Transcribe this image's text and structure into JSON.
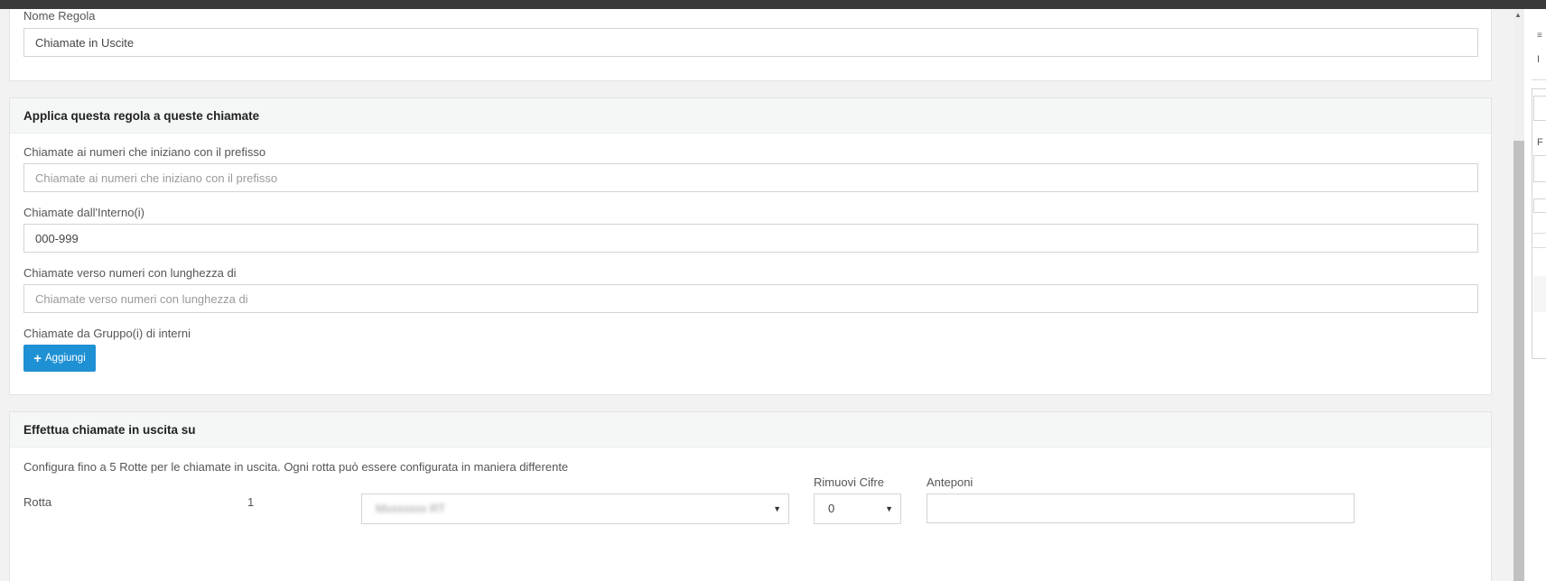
{
  "rule": {
    "name_label": "Nome Regola",
    "name_value": "Chiamate in Uscite"
  },
  "apply": {
    "title": "Applica questa regola a queste chiamate",
    "prefix_label": "Chiamate ai numeri che iniziano con il prefisso",
    "prefix_placeholder": "Chiamate ai numeri che iniziano con il prefisso",
    "extension_label": "Chiamate dall'Interno(i)",
    "extension_value": "000-999",
    "length_label": "Chiamate verso numeri con lunghezza di",
    "length_placeholder": "Chiamate verso numeri con lunghezza di",
    "group_label": "Chiamate da Gruppo(i) di interni",
    "add_label": "Aggiungi"
  },
  "outbound": {
    "title": "Effettua chiamate in uscita su",
    "description": "Configura fino a 5 Rotte per le chiamate in uscita. Ogni rotta può essere configurata in maniera differente",
    "route_label": "Rotta",
    "route_number": "1",
    "route_select_value": "Mxxxxxxx RT",
    "remove_digits_label": "Rimuovi Cifre",
    "remove_digits_value": "0",
    "prepend_label": "Anteponi",
    "prepend_value": ""
  },
  "right_panel": {
    "glyph_1": "≡",
    "glyph_2": "I",
    "glyph_3": "F"
  },
  "icons": {
    "add": "plus-icon",
    "dropdown": "caret-down-icon",
    "scroll_up": "triangle-up-icon"
  },
  "colors": {
    "primary_button": "#1e90d4",
    "top_bar": "#3a3a3a",
    "card_header": "#f5f7f7"
  }
}
